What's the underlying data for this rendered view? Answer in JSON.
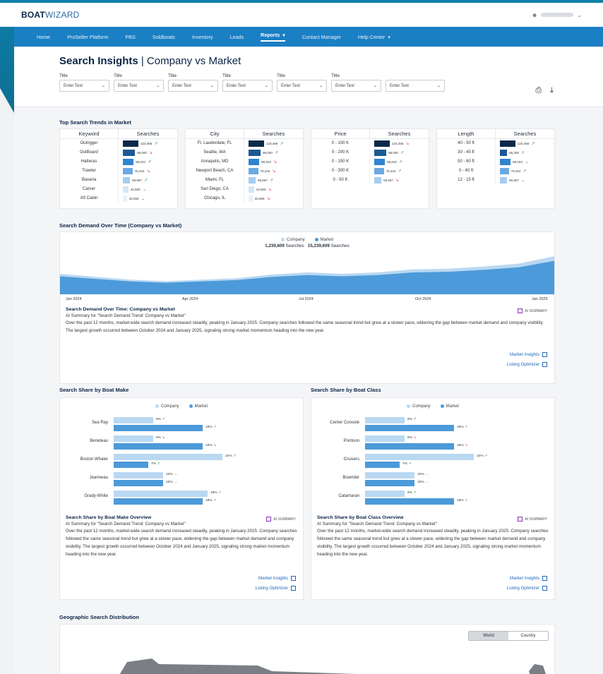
{
  "brand": {
    "bold": "BOAT",
    "light": "WIZARD"
  },
  "user": {
    "name_hidden": true
  },
  "nav": {
    "items": [
      "Home",
      "ProSeller Platform",
      "PBS",
      "Soldboats",
      "Inventory",
      "Leads",
      "Reports",
      "Contact Manager",
      "Help Center"
    ],
    "active": "Reports"
  },
  "header": {
    "title_bold": "Search Insights",
    "title_rest": " | Company vs Market"
  },
  "filters": [
    {
      "label": "Title",
      "value": "Enter Text"
    },
    {
      "label": "Title",
      "value": "Enter Text"
    },
    {
      "label": "Title",
      "value": "Enter Text"
    },
    {
      "label": "Title",
      "value": "Enter Text"
    },
    {
      "label": "Title",
      "value": "Enter Text"
    },
    {
      "label": "Title",
      "value": "Enter Text"
    },
    {
      "label": "",
      "value": "Enter Text"
    }
  ],
  "top_trends": {
    "title": "Top Search Trends in Market",
    "tables": [
      {
        "key_header": "Keyword",
        "val_header": "Searches",
        "rows": [
          {
            "key": "Outrigger",
            "value": "123,456",
            "trend": "up",
            "level": 1.0
          },
          {
            "key": "OutBoard",
            "value": "96,000",
            "trend": "down",
            "level": 0.78
          },
          {
            "key": "Hatteras",
            "value": "85,023",
            "trend": "up",
            "level": 0.69
          },
          {
            "key": "Trawler",
            "value": "76,434",
            "trend": "down",
            "level": 0.62
          },
          {
            "key": "Bavaria",
            "value": "56,567",
            "trend": "up",
            "level": 0.46
          },
          {
            "key": "Carver",
            "value": "43,500",
            "trend": "flat",
            "level": 0.35
          },
          {
            "key": "Aft Cabin",
            "value": "32,555",
            "trend": "flat",
            "level": 0.26
          }
        ]
      },
      {
        "key_header": "City",
        "val_header": "Searches",
        "rows": [
          {
            "key": "Ft. Lauderdale, FL",
            "value": "123,456",
            "trend": "up",
            "level": 1.0
          },
          {
            "key": "Seattle, WA",
            "value": "96,000",
            "trend": "up",
            "level": 0.78
          },
          {
            "key": "Annapolis, MD",
            "value": "85,023",
            "trend": "down",
            "level": 0.69
          },
          {
            "key": "Newport Beach, CA",
            "value": "76,434",
            "trend": "down",
            "level": 0.62
          },
          {
            "key": "Miami, FL",
            "value": "56,567",
            "trend": "up",
            "level": 0.46
          },
          {
            "key": "San Diego, CA",
            "value": "43,500",
            "trend": "down",
            "level": 0.35
          },
          {
            "key": "Chicago, IL",
            "value": "32,555",
            "trend": "down",
            "level": 0.26
          }
        ]
      },
      {
        "key_header": "Price",
        "val_header": "Searches",
        "rows": [
          {
            "key": "0 - 100 K",
            "value": "123,456",
            "trend": "down",
            "level": 1.0
          },
          {
            "key": "0 - 200 K",
            "value": "96,000",
            "trend": "up",
            "level": 0.78
          },
          {
            "key": "0 - 150 K",
            "value": "85,023",
            "trend": "up",
            "level": 0.69
          },
          {
            "key": "0 - 300 K",
            "value": "76,434",
            "trend": "up",
            "level": 0.62
          },
          {
            "key": "0 - 50 K",
            "value": "56,567",
            "trend": "down",
            "level": 0.46
          }
        ]
      },
      {
        "key_header": "Length",
        "val_header": "Searches",
        "rows": [
          {
            "key": "40 - 50 ft",
            "value": "123,456",
            "trend": "up",
            "level": 1.0
          },
          {
            "key": "30 - 40 ft",
            "value": "56,300",
            "trend": "up",
            "level": 0.46
          },
          {
            "key": "50 - 60 ft",
            "value": "85,023",
            "trend": "flat",
            "level": 0.69
          },
          {
            "key": "0 - 40 ft",
            "value": "70,434",
            "trend": "up",
            "level": 0.57
          },
          {
            "key": "12 - 15 ft",
            "value": "56,567",
            "trend": "flat",
            "level": 0.46
          }
        ]
      }
    ]
  },
  "demand": {
    "title": "Search Demand Over Time (Company vs Market)",
    "legend": [
      {
        "name": "Company",
        "color": "#b9d8f2"
      },
      {
        "name": "Market",
        "color": "#4c9ad9"
      }
    ],
    "company_total": "1,239,609",
    "market_total": "15,239,609",
    "unit": "Searches",
    "x_labels": [
      "Jan 2024",
      "Apr 2024",
      "Jul 2024",
      "Oct 2024",
      "Jan 2025"
    ],
    "ai": {
      "title": "Search Demand Over Time: Company vs Market",
      "badge": "AI SUMMARY",
      "sub": "AI Summary for \"Search Demand Trend: Company vs Market\"",
      "body": "Over the past 12 months, market-wide search demand increased steadily, peaking in January 2025. Company searches followed the same seasonal trend but grew at a slower pace, widening the gap between market demand and company visibility. The largest growth occurred between October 2024 and January 2025, signaling strong market momentum heading into the new year."
    },
    "links": [
      "Market Insights",
      "Listing Optimizer"
    ]
  },
  "chart_data": [
    {
      "type": "area",
      "title": "Search Demand Over Time (Company vs Market)",
      "x": [
        "Jan 2024",
        "Apr 2024",
        "Jul 2024",
        "Oct 2024",
        "Jan 2025"
      ],
      "series": [
        {
          "name": "Company",
          "values": [
            1.4,
            0.9,
            1.5,
            1.7,
            2.6
          ]
        },
        {
          "name": "Market",
          "values": [
            1.3,
            0.8,
            1.4,
            1.6,
            2.4
          ]
        }
      ]
    },
    {
      "type": "bar",
      "title": "Search Share by Boat Make",
      "categories": [
        "Sea Ray",
        "Beneteau",
        "Boston Whaler",
        "Jeanneau",
        "Grady-White"
      ],
      "series": [
        {
          "name": "Company",
          "values": [
            8,
            8,
            22,
            10,
            19
          ]
        },
        {
          "name": "Market",
          "values": [
            18,
            18,
            7,
            10,
            18
          ]
        }
      ]
    },
    {
      "type": "bar",
      "title": "Search Share by Boat Class",
      "categories": [
        "Center Console",
        "Pontoon",
        "Cruisers",
        "Bowrider",
        "Catamaran"
      ],
      "series": [
        {
          "name": "Company",
          "values": [
            8,
            8,
            22,
            10,
            8
          ]
        },
        {
          "name": "Market",
          "values": [
            18,
            18,
            7,
            10,
            18
          ]
        }
      ]
    }
  ],
  "make": {
    "title": "Search Share by Boat Make",
    "rows": [
      {
        "label": "Sea Ray",
        "c": 8,
        "ct": "up",
        "m": 18,
        "mt": "up"
      },
      {
        "label": "Beneteau",
        "c": 8,
        "ct": "down",
        "m": 18,
        "mt": "down"
      },
      {
        "label": "Boston Whaler",
        "c": 22,
        "ct": "up",
        "m": 7,
        "mt": "up"
      },
      {
        "label": "Jeanneau",
        "c": 10,
        "ct": "flat",
        "m": 10,
        "mt": "flat"
      },
      {
        "label": "Grady-White",
        "c": 19,
        "ct": "up",
        "m": 18,
        "mt": "up"
      }
    ],
    "ai": {
      "title": "Search Share by Boat Make Overview",
      "badge": "AI SUMMARY",
      "sub": "AI Summary for \"Search Demand Trend: Company vs Market\"",
      "body": "Over the past 12 months, market-wide search demand increased steadily, peaking in January 2025. Company searches followed the same seasonal trend but grew at a slower pace, widening the gap between market demand and company visibility. The largest growth occurred between October 2024 and January 2025, signaling strong market momentum heading into the new year."
    }
  },
  "klass": {
    "title": "Search Share by Boat Class",
    "rows": [
      {
        "label": "Center Console",
        "c": 8,
        "ct": "up",
        "m": 18,
        "mt": "up"
      },
      {
        "label": "Pontoon",
        "c": 8,
        "ct": "down",
        "m": 18,
        "mt": "down"
      },
      {
        "label": "Cruisers",
        "c": 22,
        "ct": "up",
        "m": 7,
        "mt": "up"
      },
      {
        "label": "Bowrider",
        "c": 10,
        "ct": "flat",
        "m": 10,
        "mt": "flat"
      },
      {
        "label": "Catamaran",
        "c": 8,
        "ct": "up",
        "m": 18,
        "mt": "up"
      }
    ],
    "ai": {
      "title": "Search Share by Boat Class Overview",
      "badge": "AI SUMMARY",
      "sub": "AI Summary for \"Search Demand Trend: Company vs Market\"",
      "body": "Over the past 12 months, market-wide search demand increased steadily, peaking in January 2025. Company searches followed the same seasonal trend but grew at a slower pace, widening the gap between market demand and company visibility. The largest growth occurred between October 2024 and January 2025, signaling strong market momentum heading into the new year."
    }
  },
  "geo": {
    "title": "Geographic Search Distribution",
    "toggle": [
      "World",
      "Country"
    ],
    "active": "World"
  },
  "colors": {
    "nav": "#1b7fc4",
    "company": "#b9d8f2",
    "market": "#4c9ad9",
    "ramp": [
      "#0b2a4a",
      "#1d5a94",
      "#2f83cf",
      "#6aa9e2",
      "#a6cdf0",
      "#d3e6f7",
      "#e8f2fb"
    ]
  }
}
